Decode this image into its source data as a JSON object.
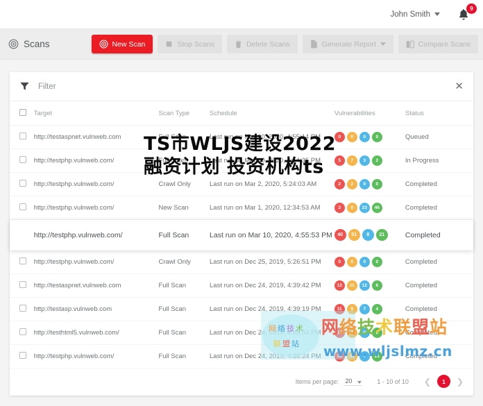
{
  "topbar": {
    "user_name": "John Smith",
    "caret_icon": "chevron-down-icon",
    "bell_icon": "bell-icon",
    "notification_count": "9"
  },
  "actionbar": {
    "title": "Scans",
    "title_icon": "scan-target-icon",
    "buttons": [
      {
        "label": "New Scan",
        "icon": "scan-target-icon",
        "state": "primary"
      },
      {
        "label": "Stop Scans",
        "icon": "stop-square-icon",
        "state": "disabled"
      },
      {
        "label": "Delete Scans",
        "icon": "trash-icon",
        "state": "disabled"
      },
      {
        "label": "Generate Report",
        "icon": "document-icon",
        "state": "disabled",
        "caret": true
      },
      {
        "label": "Compare Scans",
        "icon": "compare-icon",
        "state": "disabled"
      }
    ]
  },
  "filter": {
    "icon": "funnel-icon",
    "placeholder": "Filter",
    "close_icon": "close-icon"
  },
  "table": {
    "columns": [
      "Target",
      "Scan Type",
      "Schedule",
      "Vulnerabilities",
      "Status"
    ],
    "rows": [
      {
        "target": "http://testaspnet.vulnweb.com",
        "scan_type": "Full Scan",
        "schedule": "Last run on Mar 10, 2020, 4:55:14 PM",
        "vulns": [
          "0",
          "0",
          "0",
          "0"
        ],
        "status": "Queued",
        "hovered": false
      },
      {
        "target": "http://testphp.vulnweb.com/",
        "scan_type": "Full Scan",
        "schedule": "Last run on Mar 10, 2020, 4:54:35 PM",
        "vulns": [
          "5",
          "7",
          "3",
          "2"
        ],
        "status": "In Progress",
        "hovered": false
      },
      {
        "target": "http://testphp.vulnweb.com/",
        "scan_type": "Crawl Only",
        "schedule": "Last run on Mar 2, 2020, 5:24:03 AM",
        "vulns": [
          "2",
          "2",
          "0",
          "0"
        ],
        "status": "Completed",
        "hovered": false
      },
      {
        "target": "http://testphp.vulnweb.com/",
        "scan_type": "New Scan",
        "schedule": "Last run on Mar 1, 2020, 12:34:53 AM",
        "vulns": [
          "2",
          "0",
          "23",
          "46"
        ],
        "status": "Completed",
        "hovered": false
      },
      {
        "target": "http://testphp.vulnweb.com/",
        "scan_type": "Full Scan",
        "schedule": "Last run on Mar 10, 2020, 4:55:53 PM",
        "vulns": [
          "40",
          "51",
          "8",
          "21"
        ],
        "status": "Completed",
        "hovered": true
      },
      {
        "target": "http://testphp.vulnweb.com/",
        "scan_type": "Crawl Only",
        "schedule": "Last run on Dec 25, 2019, 5:26:51 PM",
        "vulns": [
          "0",
          "0",
          "0",
          "0"
        ],
        "status": "Completed",
        "hovered": false
      },
      {
        "target": "http://testaspnet.vulnweb.com",
        "scan_type": "Full Scan",
        "schedule": "Last run on Dec 24, 2019, 4:39:42 PM",
        "vulns": [
          "13",
          "11",
          "12",
          "6"
        ],
        "status": "Completed",
        "hovered": false
      },
      {
        "target": "http://testasp.vulnweb.com",
        "scan_type": "Full Scan",
        "schedule": "Last run on Dec 24, 2019, 4:39:19 PM",
        "vulns": [
          "11",
          "9",
          "7",
          "4"
        ],
        "status": "Completed",
        "hovered": false
      },
      {
        "target": "http://testhtml5.vulnweb.com/",
        "scan_type": "Full Scan",
        "schedule": "Last run on Dec 24, 2019, 4:38:54 PM",
        "vulns": [
          "17",
          "4",
          "0",
          "2"
        ],
        "status": "Completed",
        "hovered": false
      },
      {
        "target": "http://testphp.vulnweb.com/",
        "scan_type": "Full Scan",
        "schedule": "Last run on Dec 24, 2019, 4:38:24 PM",
        "vulns": [
          "38",
          "51",
          "7",
          "21"
        ],
        "status": "Completed",
        "hovered": false
      }
    ]
  },
  "paginator": {
    "items_per_page_label": "Items per page:",
    "items_per_page_value": "20",
    "range_label": "1 - 10 of 10",
    "prev_icon": "chevron-left-icon",
    "next_icon": "chevron-right-icon",
    "current_page": "1"
  },
  "colors": {
    "accent_red": "#ec1c24",
    "badge_critical": "#ef5350",
    "badge_high": "#f5b54a",
    "badge_medium": "#4fb8e8",
    "badge_low": "#5bbd5b"
  },
  "watermarks": {
    "headline": "TS市WLJS建设2022融资计划 投资机构ts",
    "logo_line1": "网络技术",
    "logo_line2": "联盟站",
    "brand": "网络技术联盟站",
    "url": "www.wljslmz.cn"
  }
}
